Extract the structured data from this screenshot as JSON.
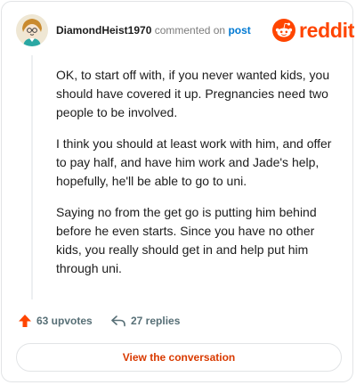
{
  "comment": {
    "username": "DiamondHeist1970",
    "commented_text": "commented on",
    "post_link": "post",
    "paragraphs": [
      "OK, to start off with, if you never wanted kids, you should have covered it up. Pregnancies need two people to be involved.",
      "I think you should at least work with him, and offer to pay half, and have him work and Jade's help, hopefully, he'll be able to go to uni.",
      "Saying no from the get go is putting him behind before he even starts. Since you have no other kids, you really should get in and help put him through uni."
    ]
  },
  "brand": {
    "logo_text": "reddit",
    "accent": "#ff4500"
  },
  "actions": {
    "upvotes": "63 upvotes",
    "replies": "27 replies"
  },
  "cta": {
    "label": "View the conversation"
  },
  "icons": {
    "avatar": "avatar",
    "logo": "reddit-logo-icon",
    "upvote": "upvote-arrow-icon",
    "reply": "reply-arrow-icon"
  }
}
